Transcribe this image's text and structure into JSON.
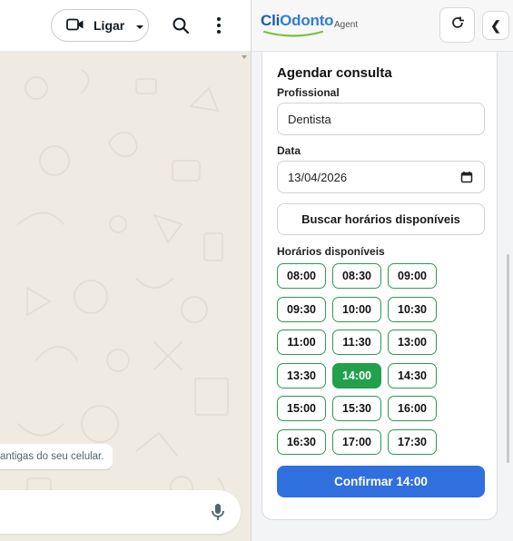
{
  "chat": {
    "call_label": "Ligar",
    "system_message": "antigas do seu celular.",
    "icons": {
      "video": "video-camera-icon",
      "dropdown": "caret-down-icon",
      "search": "search-icon",
      "menu": "more-vertical-icon",
      "mic": "microphone-icon"
    }
  },
  "panel": {
    "logo_part1": "Cli",
    "logo_part2": "Odonto",
    "subtitle": "Agent",
    "refresh_icon": "refresh-icon",
    "collapse_label": "❮",
    "colors": {
      "logo_dark": "#1e5aa8",
      "logo_light": "#2f7fd1",
      "swoosh": "#7cbf3a"
    }
  },
  "form": {
    "title": "Agendar consulta",
    "professional_label": "Profissional",
    "professional_value": "Dentista",
    "date_label": "Data",
    "date_value": "13/04/2026",
    "search_button": "Buscar horários disponíveis",
    "slots_label": "Horários disponíveis",
    "slots": [
      "08:00",
      "08:30",
      "09:00",
      "09:30",
      "10:00",
      "10:30",
      "11:00",
      "11:30",
      "13:00",
      "13:30",
      "14:00",
      "14:30",
      "15:00",
      "15:30",
      "16:00",
      "16:30",
      "17:00",
      "17:30"
    ],
    "selected_slot": "14:00",
    "confirm_button": "Confirmar 14:00",
    "colors": {
      "slot_border": "#2e9a4f",
      "selected": "#22a04b",
      "confirm": "#2f6fde"
    }
  }
}
